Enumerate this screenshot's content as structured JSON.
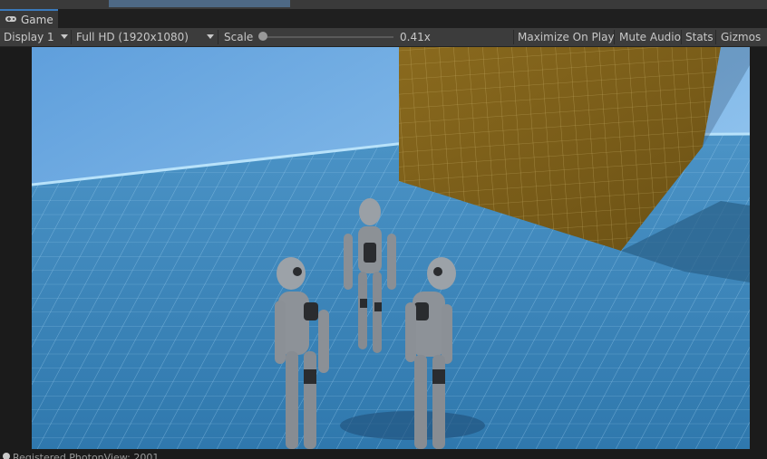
{
  "window": {
    "tab_title": "Game",
    "tab_icon": "gamepad-icon"
  },
  "toolbar": {
    "display": "Display 1",
    "resolution": "Full HD (1920x1080)",
    "scale_label": "Scale",
    "scale_value": "0.41x",
    "scale_fraction": 0.0,
    "maximize_on_play": "Maximize On Play",
    "mute_audio": "Mute Audio",
    "stats": "Stats",
    "gizmos": "Gizmos"
  },
  "scene": {
    "sky_color": "#7fb6e6",
    "floor_color": "#3f86b8",
    "grid_color": "#9fd0f0",
    "cube_color": "#7a5c18",
    "robot_color": "#8b8e93",
    "robot_count": 3
  },
  "status": {
    "message": "Registered PhotonView: 2001",
    "icon": "info-icon"
  }
}
